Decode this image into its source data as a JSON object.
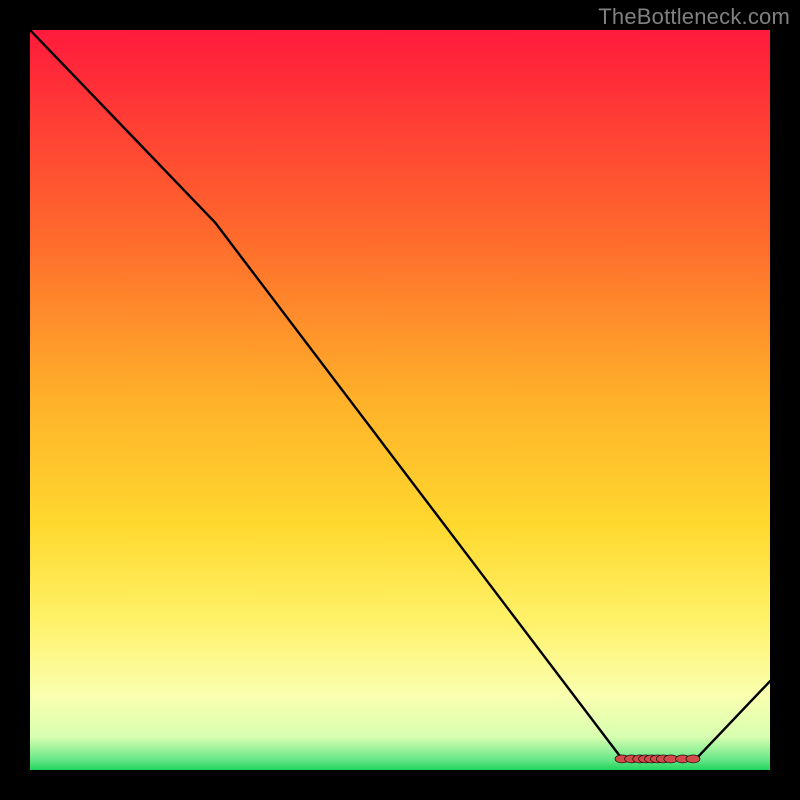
{
  "attribution": "TheBottleneck.com",
  "colors": {
    "bg": "#000000",
    "grad_top": "#ff1a3c",
    "grad_upper_mid": "#ff8a2a",
    "grad_mid": "#ffd22e",
    "grad_low_mid": "#ffef66",
    "grad_lower": "#f7ffb2",
    "grad_bottom": "#32e070",
    "line": "#000000",
    "marker": "#d24a49"
  },
  "chart_data": {
    "type": "line",
    "title": "",
    "xlabel": "",
    "ylabel": "",
    "xlim": [
      0,
      100
    ],
    "ylim": [
      0,
      100
    ],
    "x": [
      0,
      25,
      80,
      90,
      100
    ],
    "y": [
      100,
      74,
      1.5,
      1.5,
      12
    ],
    "gradient_stops": [
      {
        "pos": 0.0,
        "color": "#ff1a3c"
      },
      {
        "pos": 0.28,
        "color": "#ff6a2c"
      },
      {
        "pos": 0.5,
        "color": "#ffb12a"
      },
      {
        "pos": 0.67,
        "color": "#ffd92e"
      },
      {
        "pos": 0.8,
        "color": "#fff26a"
      },
      {
        "pos": 0.9,
        "color": "#faffb0"
      },
      {
        "pos": 0.955,
        "color": "#d8ffb0"
      },
      {
        "pos": 0.985,
        "color": "#6de88a"
      },
      {
        "pos": 1.0,
        "color": "#1fd35e"
      }
    ],
    "markers_x": [
      80.0,
      81.3,
      82.4,
      83.2,
      84.0,
      84.8,
      85.6,
      86.6,
      88.2,
      89.6
    ]
  }
}
